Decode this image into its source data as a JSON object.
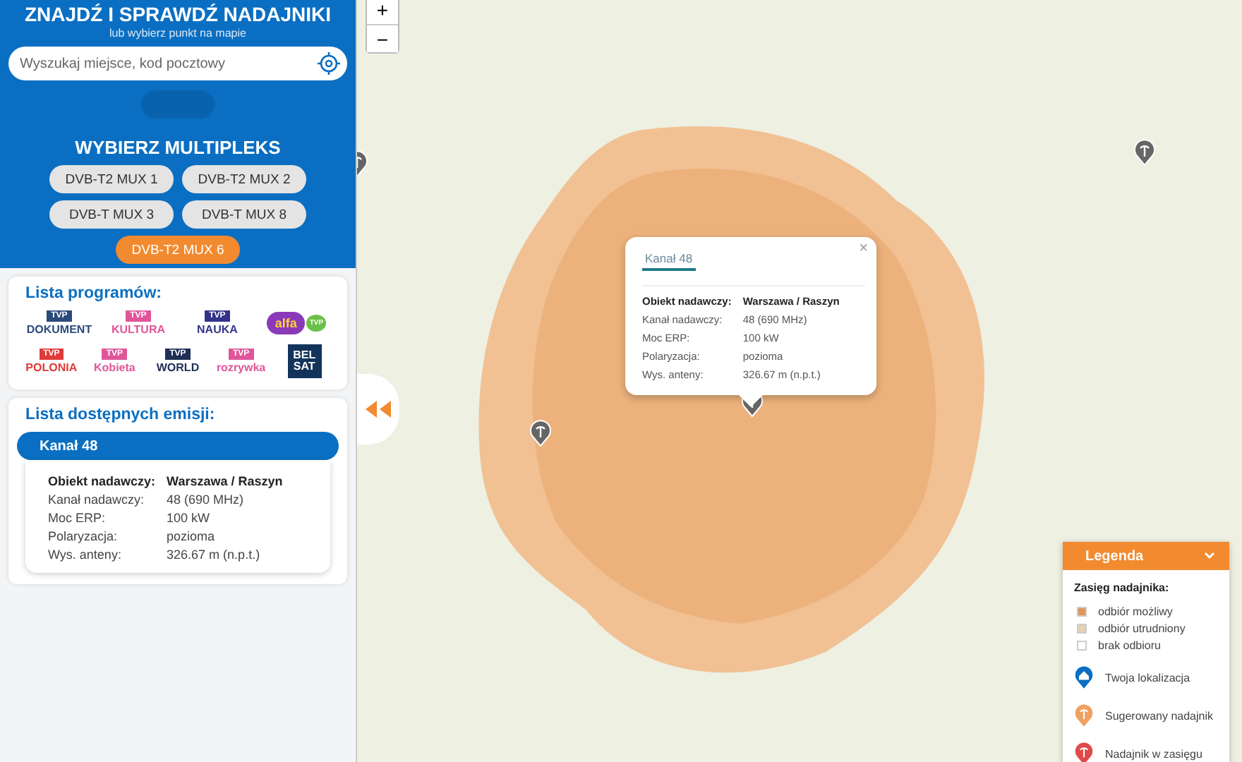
{
  "header": {
    "title": "ZNAJDŹ I SPRAWDŹ NADAJNIKI",
    "subtitle": "lub wybierz punkt na mapie"
  },
  "search": {
    "placeholder": "Wyszukaj miejsce, kod pocztowy"
  },
  "multiplex": {
    "title": "WYBIERZ MULTIPLEKS",
    "options": [
      {
        "label": "DVB-T2 MUX 1",
        "selected": false
      },
      {
        "label": "DVB-T2 MUX 2",
        "selected": false
      },
      {
        "label": "DVB-T MUX 3",
        "selected": false
      },
      {
        "label": "DVB-T MUX 8",
        "selected": false
      },
      {
        "label": "DVB-T2 MUX 6",
        "selected": true
      }
    ]
  },
  "programs": {
    "title": "Lista programów:",
    "logos": [
      {
        "kind": "tvp",
        "badge": "TVP",
        "name": "DOKUMENT",
        "color": "#2a4a7a"
      },
      {
        "kind": "tvp",
        "badge": "TVP",
        "name": "KULTURA",
        "color": "#e0559a"
      },
      {
        "kind": "tvp",
        "badge": "TVP",
        "name": "NAUKA",
        "color": "#33338a"
      },
      {
        "kind": "alfa",
        "badge": "TVP",
        "name": "alfa",
        "color": "#8a3ab8"
      },
      {
        "kind": "tvp",
        "badge": "TVP",
        "name": "POLONIA",
        "color": "#e03a3a"
      },
      {
        "kind": "tvp",
        "badge": "TVP",
        "name": "Kobieta",
        "color": "#e0559a"
      },
      {
        "kind": "tvp",
        "badge": "TVP",
        "name": "WORLD",
        "color": "#1f2f55"
      },
      {
        "kind": "tvp",
        "badge": "TVP",
        "name": "rozrywka",
        "color": "#e0559a"
      },
      {
        "kind": "belsat",
        "badge": "BEL",
        "name": "SAT",
        "color": "#12345a"
      }
    ]
  },
  "emissions": {
    "title": "Lista dostępnych emisji:",
    "items": [
      {
        "channel": "Kanał 48",
        "expanded": true,
        "station_label": "Obiekt nadawczy:",
        "station": "Warszawa / Raszyn",
        "rows": [
          {
            "label": "Kanał nadawczy:",
            "value": "48 (690 MHz)"
          },
          {
            "label": "Moc ERP:",
            "value": "100 kW"
          },
          {
            "label": "Polaryzacja:",
            "value": "pozioma"
          },
          {
            "label": "Wys. anteny:",
            "value": "326.67 m (n.p.t.)"
          }
        ]
      }
    ]
  },
  "map": {
    "zoom_in": "+",
    "zoom_out": "−",
    "popup": {
      "tab": "Kanał 48",
      "close": "×",
      "station_label": "Obiekt nadawczy:",
      "station": "Warszawa / Raszyn",
      "rows": [
        {
          "label": "Kanał nadawczy:",
          "value": "48 (690 MHz)"
        },
        {
          "label": "Moc ERP:",
          "value": "100 kW"
        },
        {
          "label": "Polaryzacja:",
          "value": "pozioma"
        },
        {
          "label": "Wys. anteny:",
          "value": "326.67 m (n.p.t.)"
        }
      ]
    },
    "legend": {
      "title": "Legenda",
      "expanded": true,
      "subtitle": "Zasięg nadajnika:",
      "items": [
        {
          "kind": "swatch",
          "label": "odbiór możliwy",
          "color": "#e0965a"
        },
        {
          "kind": "swatch",
          "label": "odbiór utrudniony",
          "color": "#e6d2b4"
        },
        {
          "kind": "swatch",
          "label": "brak odbioru",
          "color": "#ffffff"
        },
        {
          "kind": "home",
          "label": "Twoja lokalizacja",
          "color": "#0a6fc2"
        },
        {
          "kind": "pin",
          "label": "Sugerowany nadajnik",
          "color": "#f0a060"
        },
        {
          "kind": "pin",
          "label": "Nadajnik w zasięgu",
          "color": "#e04a4a"
        }
      ]
    }
  }
}
